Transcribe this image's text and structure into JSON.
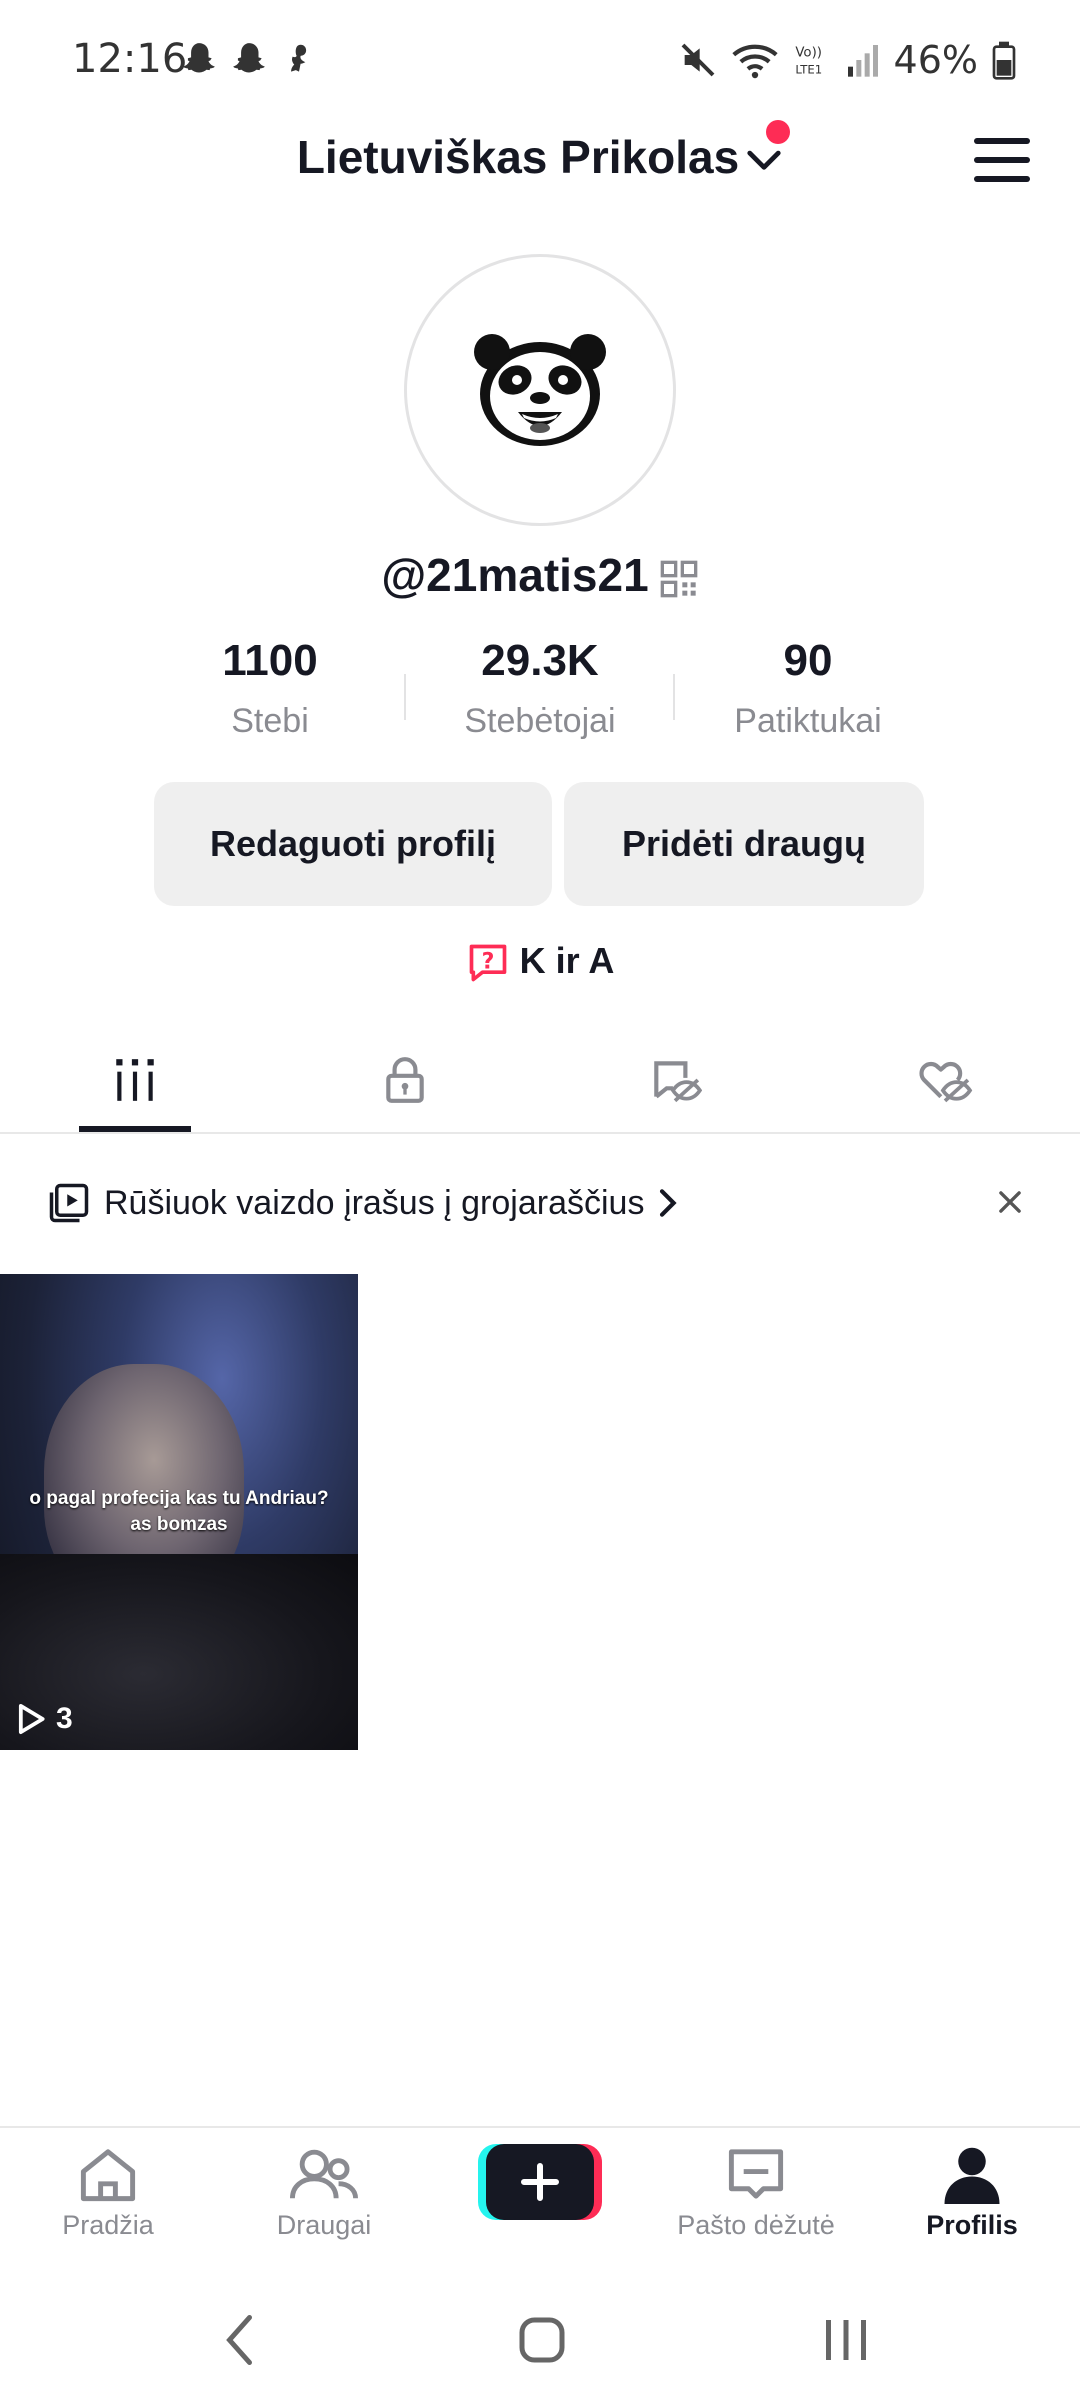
{
  "status_bar": {
    "time": "12:16",
    "battery": "46%",
    "icons": [
      "snapchat-icon",
      "snapchat-icon",
      "snapchat-alt-icon",
      "mute-icon",
      "wifi-icon",
      "volte-icon",
      "signal-icon",
      "battery-icon"
    ]
  },
  "header": {
    "title": "Lietuviškas Prikolas",
    "notification_color": "#fe2c55"
  },
  "profile": {
    "username": "@21matis21",
    "avatar_icon": "panda-icon",
    "stats": [
      {
        "value": "1100",
        "label": "Stebi"
      },
      {
        "value": "29.3K",
        "label": "Stebėtojai"
      },
      {
        "value": "90",
        "label": "Patiktukai"
      }
    ],
    "edit_button": "Redaguoti profilį",
    "add_friends_button": "Pridėti draugų",
    "qa_label": "K ir A"
  },
  "tabs": [
    {
      "icon": "grid-icon",
      "active": true
    },
    {
      "icon": "lock-icon",
      "active": false
    },
    {
      "icon": "hidden-post-icon",
      "active": false
    },
    {
      "icon": "hidden-like-icon",
      "active": false
    }
  ],
  "playlist_banner": {
    "text": "Rūšiuok vaizdo įrašus į grojaraščius"
  },
  "videos": [
    {
      "caption_line1": "o pagal profecija kas tu Andriau?",
      "caption_line2": "as bomzas",
      "views": "3"
    }
  ],
  "bottom_nav": [
    {
      "label": "Pradžia",
      "icon": "home-icon",
      "active": false
    },
    {
      "label": "Draugai",
      "icon": "friends-icon",
      "active": false
    },
    {
      "label": "",
      "icon": "plus-icon",
      "active": false
    },
    {
      "label": "Pašto dėžutė",
      "icon": "inbox-icon",
      "active": false
    },
    {
      "label": "Profilis",
      "icon": "profile-icon",
      "active": true
    }
  ],
  "colors": {
    "accent": "#fe2c55",
    "cyan": "#25f4ee",
    "text": "#161823",
    "muted": "#8a8b91",
    "button_bg": "#efefef"
  }
}
